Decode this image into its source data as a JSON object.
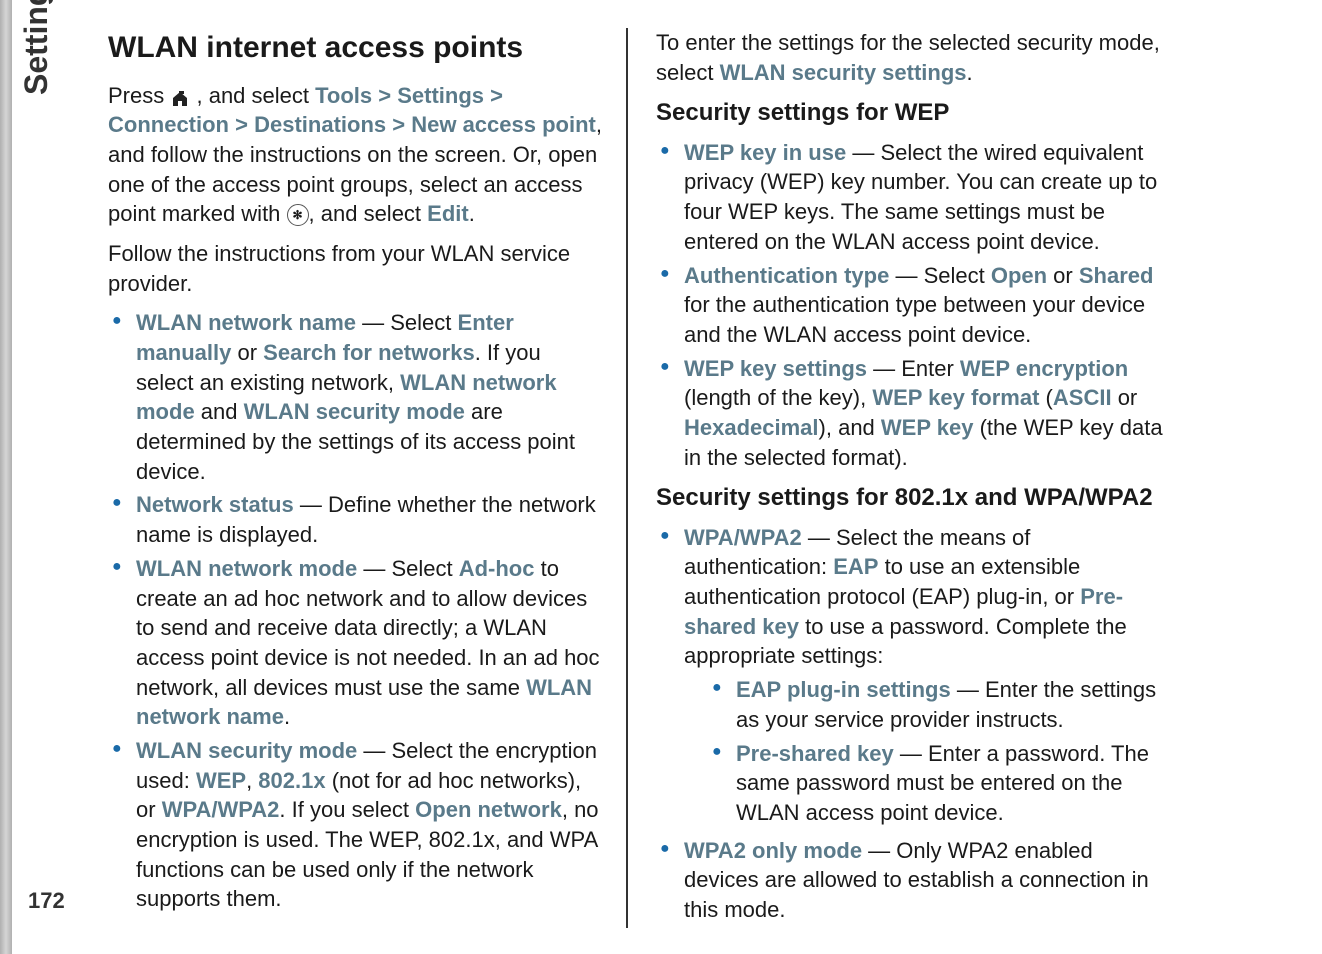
{
  "sidebar": {
    "label": "Settings",
    "page_number": "172"
  },
  "left": {
    "heading": "WLAN internet access points",
    "para1_a": "Press ",
    "para1_b": " , and select ",
    "tools": "Tools",
    "settings": "Settings",
    "connection": "Connection",
    "destinations": "Destinations",
    "new_access_point": "New access point",
    "para1_c": ", and follow the instructions on the screen. Or, open one of the access point groups, select an access point marked with ",
    "para1_d": ", and select ",
    "edit": "Edit",
    "para1_e": ".",
    "para2": "Follow the instructions from your WLAN service provider.",
    "item1_label": "WLAN network name",
    "item1_a": " — Select ",
    "enter_manually": "Enter manually",
    "item1_b": " or ",
    "search_networks": "Search for networks",
    "item1_c": ". If you select an existing network, ",
    "wlan_network_mode": "WLAN network mode",
    "item1_d": " and ",
    "wlan_security_mode": "WLAN security mode",
    "item1_e": " are determined by the settings of its access point device.",
    "item2_label": "Network status",
    "item2_text": " — Define whether the network name is displayed.",
    "item3_label": "WLAN network mode",
    "item3_a": " — Select ",
    "adhoc": "Ad-hoc",
    "item3_b": " to create an ad hoc network and to allow devices to send and receive data directly; a WLAN access point device is not needed. In an ad hoc network, all devices must use the same ",
    "wlan_network_name": "WLAN network name",
    "item3_c": ".",
    "item4_label": "WLAN security mode",
    "item4_a": " — Select the encryption used: ",
    "wep": "WEP",
    "item4_b": ", ",
    "8021x": "802.1x",
    "item4_c": " (not for ad hoc networks), or ",
    "wpa_wpa2": "WPA/WPA2",
    "item4_d": ". If you select ",
    "open_network": "Open network",
    "item4_e": ", no encryption is used. The WEP, 802.1x, and WPA functions can be used only if the network supports them."
  },
  "right": {
    "para1_a": "To enter the settings for the selected security mode, select ",
    "wlan_sec_settings": "WLAN security settings",
    "para1_b": ".",
    "h3_wep": "Security settings for WEP",
    "wep1_label": "WEP key in use",
    "wep1_text": " — Select the wired equivalent privacy (WEP) key number. You can create up to four WEP keys. The same settings must be entered on the WLAN access point device.",
    "wep2_label": "Authentication type",
    "wep2_a": " — Select ",
    "open": "Open",
    "wep2_b": " or ",
    "shared": "Shared",
    "wep2_c": " for the authentication type between your device and the WLAN access point device.",
    "wep3_label": "WEP key settings",
    "wep3_a": " — Enter ",
    "wep_encryption": "WEP encryption",
    "wep3_b": " (length of the key), ",
    "wep_key_format": "WEP key format",
    "wep3_c": " (",
    "ascii": "ASCII",
    "wep3_d": " or ",
    "hex": "Hexadecimal",
    "wep3_e": "), and ",
    "wep_key": "WEP key",
    "wep3_f": " (the WEP key data in the selected format).",
    "h3_wpa": "Security settings for 802.1x and WPA/WPA2",
    "wpa1_label": "WPA/WPA2",
    "wpa1_a": " — Select the means of authentication: ",
    "eap": "EAP",
    "wpa1_b": " to use an extensible authentication protocol (EAP) plug-in, or ",
    "preshared_key": "Pre-shared key",
    "wpa1_c": " to use a password. Complete the appropriate settings:",
    "sub1_label": "EAP plug-in settings",
    "sub1_text": " — Enter the settings as your service provider instructs.",
    "sub2_label": "Pre-shared key",
    "sub2_text": " — Enter a password. The same password must be entered on the WLAN access point device.",
    "wpa2_label": "WPA2 only mode",
    "wpa2_text": " — Only WPA2 enabled devices are allowed to establish a connection in this mode."
  }
}
